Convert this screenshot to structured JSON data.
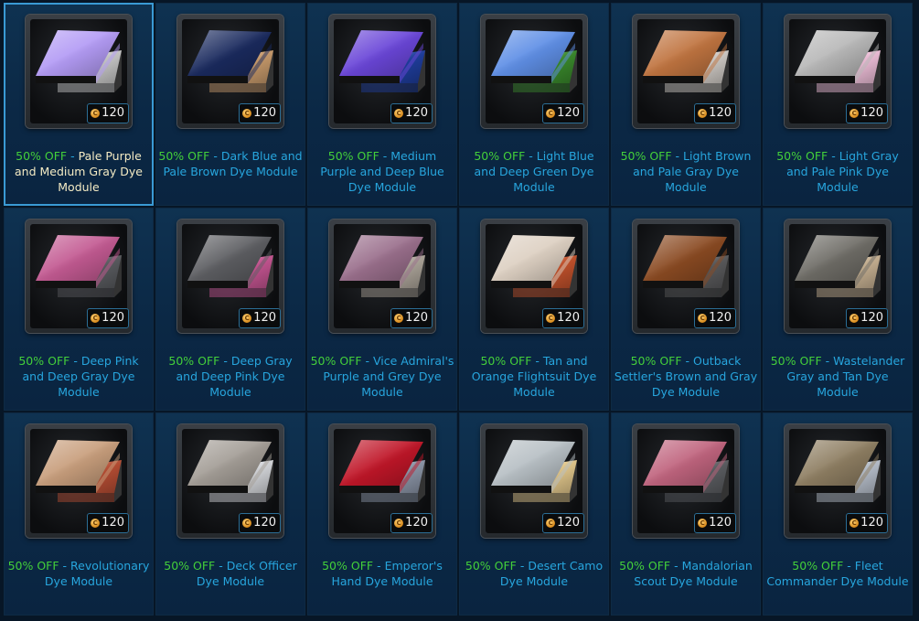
{
  "products": [
    {
      "discount": "50% OFF",
      "name": "Pale Purple and Medium Gray Dye Module",
      "price": "120",
      "selected": true,
      "primary_color": "#b39bf5",
      "secondary_color": "#c8c8c8"
    },
    {
      "discount": "50% OFF",
      "name": "Dark Blue and Pale Brown Dye Module",
      "price": "120",
      "primary_color": "#1a2a5e",
      "secondary_color": "#c99b6c"
    },
    {
      "discount": "50% OFF",
      "name": "Medium Purple and Deep Blue Dye Module",
      "price": "120",
      "primary_color": "#6a46d8",
      "secondary_color": "#1f3e9e"
    },
    {
      "discount": "50% OFF",
      "name": "Light Blue and Deep Green Dye Module",
      "price": "120",
      "primary_color": "#5f8fe6",
      "secondary_color": "#3a8a2c"
    },
    {
      "discount": "50% OFF",
      "name": "Light Brown and Pale Gray Dye Module",
      "price": "120",
      "primary_color": "#c07440",
      "secondary_color": "#d0cbc6"
    },
    {
      "discount": "50% OFF",
      "name": "Light Gray and Pale Pink Dye Module",
      "price": "120",
      "primary_color": "#b8b8b8",
      "secondary_color": "#efbfd9"
    },
    {
      "discount": "50% OFF",
      "name": "Deep Pink and Deep Gray Dye Module",
      "price": "120",
      "primary_color": "#c35a92",
      "secondary_color": "#5a5c60"
    },
    {
      "discount": "50% OFF",
      "name": "Deep Gray and Deep Pink Dye Module",
      "price": "120",
      "primary_color": "#5d5e62",
      "secondary_color": "#c65592"
    },
    {
      "discount": "50% OFF",
      "name": "Vice Admiral's Purple and Grey Dye Module",
      "price": "120",
      "primary_color": "#9a6f8c",
      "secondary_color": "#ada59a"
    },
    {
      "discount": "50% OFF",
      "name": "Tan and Orange Flightsuit Dye Module",
      "price": "120",
      "primary_color": "#ddd0c2",
      "secondary_color": "#c4522c"
    },
    {
      "discount": "50% OFF",
      "name": "Outback Settler's Brown and Gray Dye Module",
      "price": "120",
      "primary_color": "#8a4a22",
      "secondary_color": "#5a5a5c"
    },
    {
      "discount": "50% OFF",
      "name": "Wastelander Gray and Tan Dye Module",
      "price": "120",
      "primary_color": "#6e6c66",
      "secondary_color": "#c8b293"
    },
    {
      "discount": "50% OFF",
      "name": "Revolutionary Dye Module",
      "price": "120",
      "primary_color": "#c89e7c",
      "secondary_color": "#b84e34"
    },
    {
      "discount": "50% OFF",
      "name": "Deck Officer Dye Module",
      "price": "120",
      "primary_color": "#a39d96",
      "secondary_color": "#d6d8dc"
    },
    {
      "discount": "50% OFF",
      "name": "Emperor's Hand Dye Module",
      "price": "120",
      "primary_color": "#c01628",
      "secondary_color": "#8c96a8"
    },
    {
      "discount": "50% OFF",
      "name": "Desert Camo Dye Module",
      "price": "120",
      "primary_color": "#b7bfc4",
      "secondary_color": "#e3c88c"
    },
    {
      "discount": "50% OFF",
      "name": "Mandalorian Scout Dye Module",
      "price": "120",
      "primary_color": "#c0647e",
      "secondary_color": "#5c5e62"
    },
    {
      "discount": "50% OFF",
      "name": "Fleet Commander Dye Module",
      "price": "120",
      "primary_color": "#8e7e62",
      "secondary_color": "#b8c0cc"
    }
  ]
}
